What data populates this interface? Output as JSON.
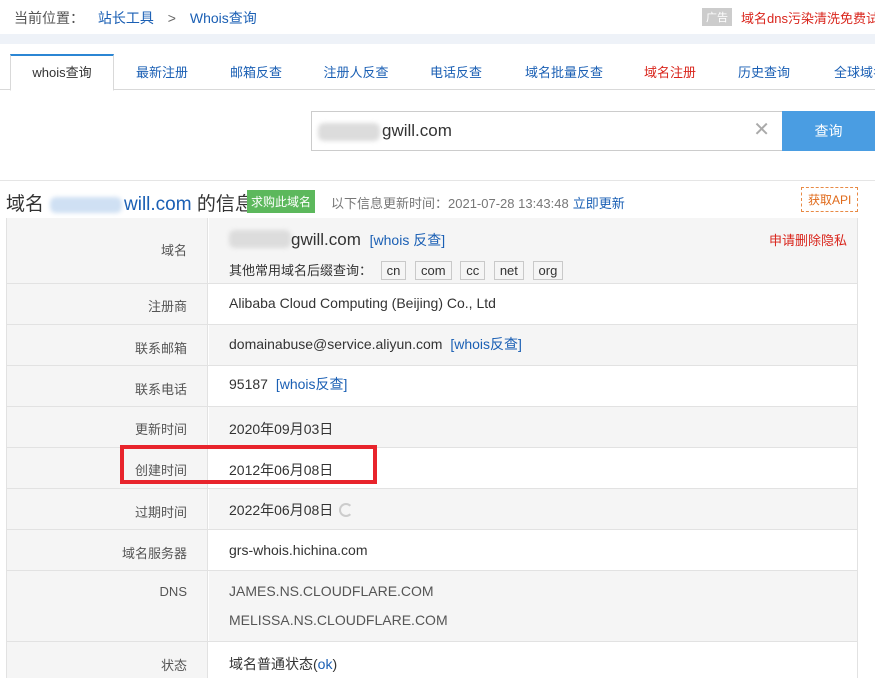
{
  "topbar": {
    "location_label": "当前位置：",
    "crumb_1": "站长工具",
    "crumb_sep": ">",
    "crumb_2": "Whois查询",
    "ad_tag": "广告",
    "ad_text": "域名dns污染清洗免费试"
  },
  "tabs": [
    "whois查询",
    "最新注册",
    "邮箱反查",
    "注册人反查",
    "电话反查",
    "域名批量反查",
    "域名注册",
    "历史查询",
    "全球域名"
  ],
  "search": {
    "value": "gwill.com",
    "button": "查询"
  },
  "info_head": {
    "prefix": "域名",
    "domain": "will.com",
    "suffix": "的信息",
    "buy_badge": "求购此域名",
    "update_label": "以下信息更新时间：2021-07-28 13:43:48",
    "update_link": "立即更新",
    "api_link": "获取API"
  },
  "rows": {
    "domain": {
      "label": "域名",
      "value": "gwill.com",
      "link": "[whois 反查]",
      "suffix_label": "其他常用域名后缀查询：",
      "suffixes": [
        "cn",
        "com",
        "cc",
        "net",
        "org"
      ],
      "privacy": "申请删除隐私"
    },
    "registrar": {
      "label": "注册商",
      "value": "Alibaba Cloud Computing (Beijing) Co., Ltd"
    },
    "email": {
      "label": "联系邮箱",
      "value": "domainabuse@service.aliyun.com",
      "link": "[whois反查]"
    },
    "phone": {
      "label": "联系电话",
      "value": "95187",
      "link": "[whois反查]"
    },
    "updated": {
      "label": "更新时间",
      "value": "2020年09月03日"
    },
    "created": {
      "label": "创建时间",
      "value": "2012年06月08日"
    },
    "expires": {
      "label": "过期时间",
      "value": "2022年06月08日"
    },
    "nameserver": {
      "label": "域名服务器",
      "value": "grs-whois.hichina.com"
    },
    "dns": {
      "label": "DNS",
      "values": [
        "JAMES.NS.CLOUDFLARE.COM",
        "MELISSA.NS.CLOUDFLARE.COM"
      ]
    },
    "status": {
      "label": "状态",
      "prefix": "域名普通状态(",
      "link": "ok",
      "suffix": ")"
    }
  },
  "colors": {
    "accent": "#1a5fb4",
    "search_button": "#4a9de2",
    "buy_badge": "#5cb85c",
    "highlight": "#e8242c",
    "red_text": "#d9251c"
  }
}
